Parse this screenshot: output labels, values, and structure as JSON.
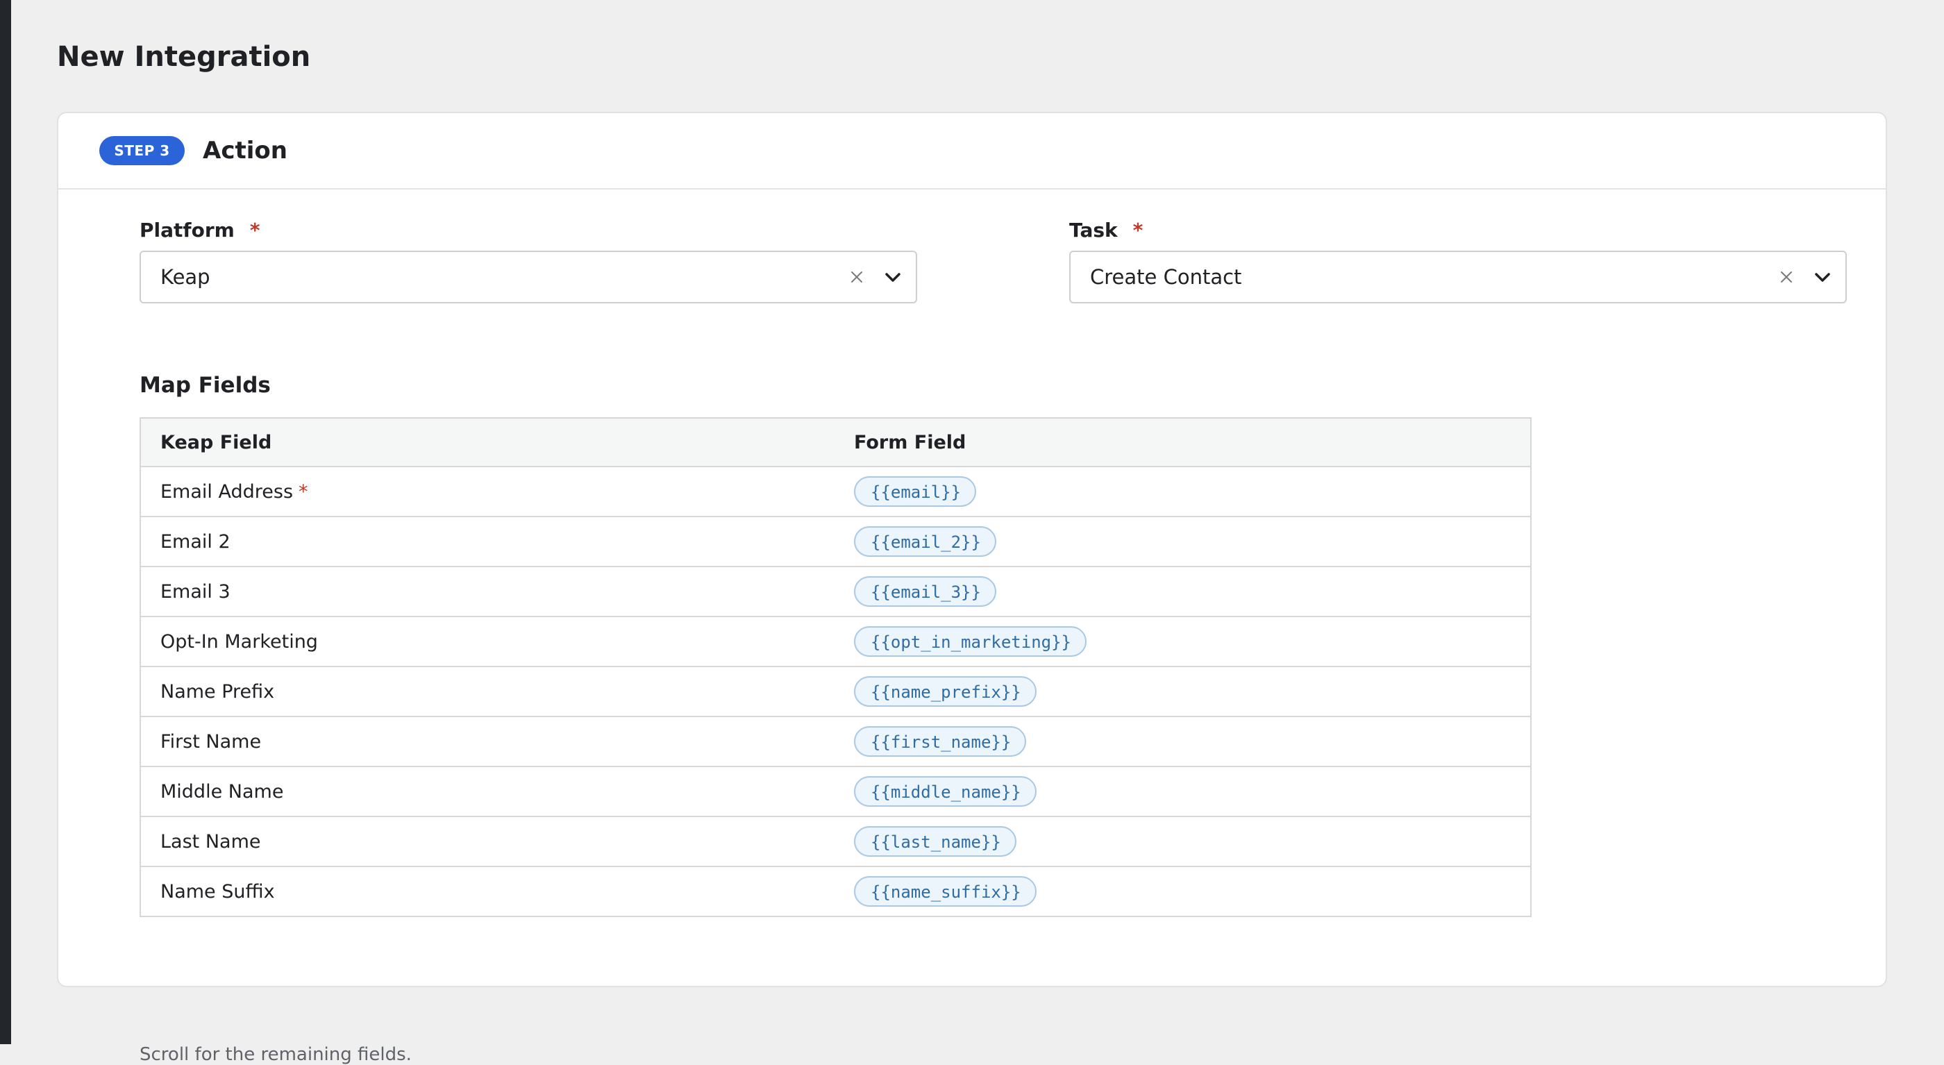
{
  "page": {
    "title": "New Integration"
  },
  "step": {
    "badge": "STEP 3",
    "title": "Action"
  },
  "platform_field": {
    "label": "Platform",
    "required_mark": "*",
    "value": "Keap"
  },
  "task_field": {
    "label": "Task",
    "required_mark": "*",
    "value": "Create Contact"
  },
  "map_fields": {
    "title": "Map Fields",
    "columns": [
      "Keap Field",
      "Form Field"
    ],
    "rows": [
      {
        "keap_field": "Email Address",
        "required_mark": "*",
        "form_field": "{{email}}"
      },
      {
        "keap_field": "Email 2",
        "required_mark": "",
        "form_field": "{{email_2}}"
      },
      {
        "keap_field": "Email 3",
        "required_mark": "",
        "form_field": "{{email_3}}"
      },
      {
        "keap_field": "Opt-In Marketing",
        "required_mark": "",
        "form_field": "{{opt_in_marketing}}"
      },
      {
        "keap_field": "Name Prefix",
        "required_mark": "",
        "form_field": "{{name_prefix}}"
      },
      {
        "keap_field": "First Name",
        "required_mark": "",
        "form_field": "{{first_name}}"
      },
      {
        "keap_field": "Middle Name",
        "required_mark": "",
        "form_field": "{{middle_name}}"
      },
      {
        "keap_field": "Last Name",
        "required_mark": "",
        "form_field": "{{last_name}}"
      },
      {
        "keap_field": "Name Suffix",
        "required_mark": "",
        "form_field": "{{name_suffix}}"
      }
    ],
    "hint": "Scroll for the remaining fields."
  },
  "icons": {
    "clear": "close-icon",
    "dropdown": "chevron-down-icon"
  },
  "colors": {
    "accent": "#2b63d9",
    "required": "#c0392b",
    "token_text": "#2f6ca4",
    "token_bg": "#edf5fc",
    "token_border": "#a9c8e4"
  }
}
